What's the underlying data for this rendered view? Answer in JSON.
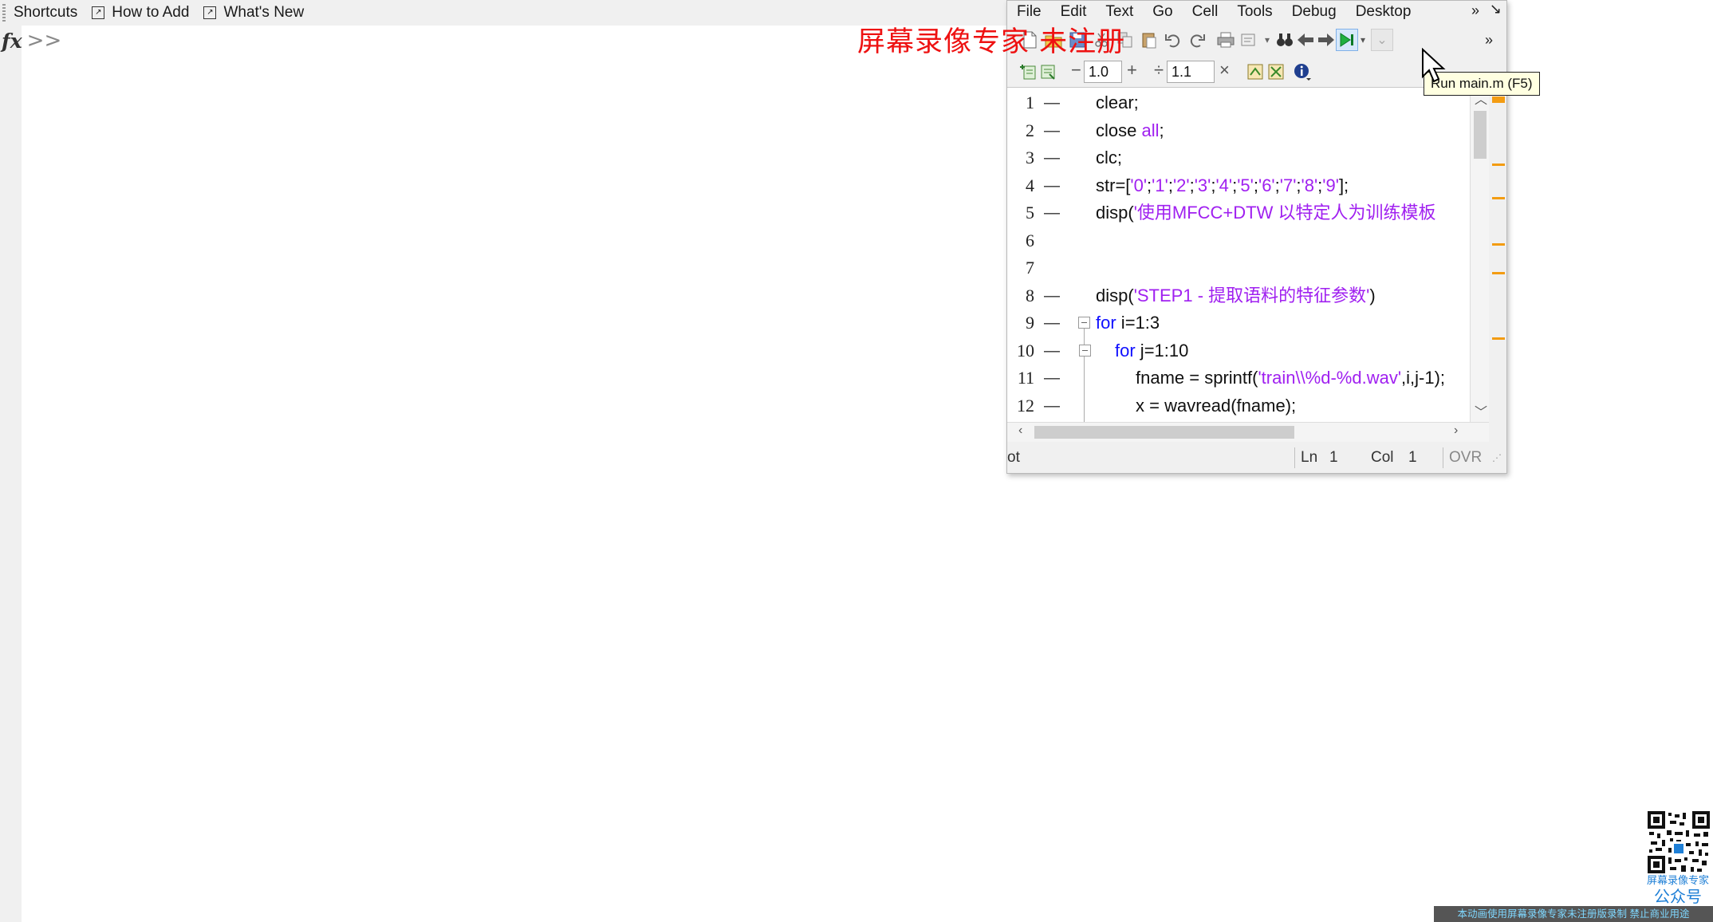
{
  "shortcuts": {
    "items": [
      {
        "label": "Shortcuts"
      },
      {
        "label": "How to Add",
        "icon": "help-icon"
      },
      {
        "label": "What's New",
        "icon": "help-icon"
      }
    ]
  },
  "command": {
    "prompt_symbol": "fx",
    "chevron": ">>"
  },
  "editor": {
    "menu": [
      "File",
      "Edit",
      "Text",
      "Go",
      "Cell",
      "Tools",
      "Debug",
      "Desktop"
    ],
    "menu_more": "»",
    "cell_toolbar": {
      "minus": "−",
      "value1": "1.0",
      "plus": "+",
      "divide": "÷",
      "value2": "1.1",
      "times": "×"
    },
    "code_lines": [
      {
        "num": "1",
        "segments": [
          {
            "t": "clear;",
            "c": "plain"
          }
        ]
      },
      {
        "num": "2",
        "segments": [
          {
            "t": "close ",
            "c": "plain"
          },
          {
            "t": "all",
            "c": "str"
          },
          {
            "t": ";",
            "c": "plain"
          }
        ]
      },
      {
        "num": "3",
        "segments": [
          {
            "t": "clc;",
            "c": "plain"
          }
        ]
      },
      {
        "num": "4",
        "segments": [
          {
            "t": "str=[",
            "c": "plain"
          },
          {
            "t": "'0'",
            "c": "str"
          },
          {
            "t": ";",
            "c": "plain"
          },
          {
            "t": "'1'",
            "c": "str"
          },
          {
            "t": ";",
            "c": "plain"
          },
          {
            "t": "'2'",
            "c": "str"
          },
          {
            "t": ";",
            "c": "plain"
          },
          {
            "t": "'3'",
            "c": "str"
          },
          {
            "t": ";",
            "c": "plain"
          },
          {
            "t": "'4'",
            "c": "str"
          },
          {
            "t": ";",
            "c": "plain"
          },
          {
            "t": "'5'",
            "c": "str"
          },
          {
            "t": ";",
            "c": "plain"
          },
          {
            "t": "'6'",
            "c": "str"
          },
          {
            "t": ";",
            "c": "plain"
          },
          {
            "t": "'7'",
            "c": "str"
          },
          {
            "t": ";",
            "c": "plain"
          },
          {
            "t": "'8'",
            "c": "str"
          },
          {
            "t": ";",
            "c": "plain"
          },
          {
            "t": "'9'",
            "c": "str"
          },
          {
            "t": "];",
            "c": "plain"
          }
        ]
      },
      {
        "num": "5",
        "segments": [
          {
            "t": "disp(",
            "c": "plain"
          },
          {
            "t": "'使用MFCC+DTW 以特定人为训练模板",
            "c": "str"
          }
        ]
      },
      {
        "num": "6",
        "segments": []
      },
      {
        "num": "7",
        "segments": []
      },
      {
        "num": "8",
        "segments": [
          {
            "t": "disp(",
            "c": "plain"
          },
          {
            "t": "'STEP1 - 提取语料的特征参数'",
            "c": "str"
          },
          {
            "t": ")",
            "c": "plain"
          }
        ]
      },
      {
        "num": "9",
        "segments": [
          {
            "t": "for",
            "c": "kw"
          },
          {
            "t": " i=1:3",
            "c": "plain"
          }
        ]
      },
      {
        "num": "10",
        "segments": [
          {
            "t": "for",
            "c": "kw"
          },
          {
            "t": " j=1:10",
            "c": "plain"
          }
        ]
      },
      {
        "num": "11",
        "segments": [
          {
            "t": "fname = sprintf(",
            "c": "plain"
          },
          {
            "t": "'train\\\\%d-%d.wav'",
            "c": "str"
          },
          {
            "t": ",i,j-1);",
            "c": "plain"
          }
        ]
      },
      {
        "num": "12",
        "segments": [
          {
            "t": "x = wavread(fname);",
            "c": "plain"
          }
        ]
      }
    ],
    "status": {
      "left": "ot",
      "ln_label": "Ln",
      "ln_value": "1",
      "col_label": "Col",
      "col_value": "1",
      "mode": "OVR"
    },
    "tooltip": "Run main.m (F5)"
  },
  "watermark": {
    "text": "屏幕录像专家 未注册",
    "color": "#ee1111",
    "qr_caption": "屏幕录像专家",
    "qr_caption2": "公众号",
    "footer": "本动画使用屏幕录像专家未注册版录制  禁止商业用途"
  }
}
